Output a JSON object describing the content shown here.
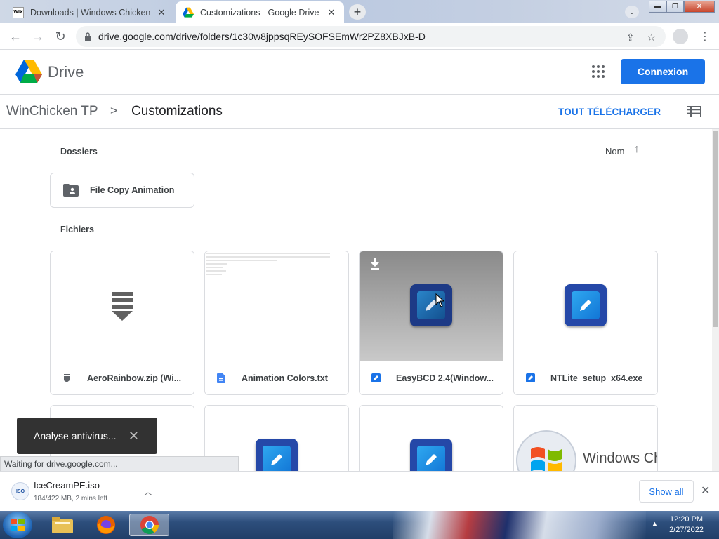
{
  "browser": {
    "tabs": [
      {
        "title": "Downloads | Windows Chicken",
        "favicon": "wix-icon",
        "active": false
      },
      {
        "title": "Customizations - Google Drive",
        "favicon": "drive-icon",
        "active": true
      }
    ],
    "url": "drive.google.com/drive/folders/1c30w8jppsqREySOFSEmWr2PZ8XBJxB-D",
    "status_text": "Waiting for drive.google.com..."
  },
  "drive": {
    "app_name": "Drive",
    "signin_label": "Connexion",
    "breadcrumb": [
      "WinChicken TP",
      "Customizations"
    ],
    "download_all_label": "TOUT TÉLÉCHARGER",
    "sections": {
      "folders_label": "Dossiers",
      "files_label": "Fichiers"
    },
    "sort_label": "Nom",
    "folders": [
      {
        "name": "File Copy Animation"
      }
    ],
    "files": [
      {
        "name": "AeroRainbow.zip (Wi...",
        "type_icon": "zip-icon",
        "thumb": "zip-icon"
      },
      {
        "name": "Animation Colors.txt",
        "type_icon": "doc-icon",
        "thumb": "text-preview"
      },
      {
        "name": "EasyBCD 2.4(Window...",
        "type_icon": "exe-icon",
        "thumb": "app-icon",
        "hovered": true
      },
      {
        "name": "NTLite_setup_x64.exe",
        "type_icon": "exe-icon",
        "thumb": "app-icon"
      }
    ],
    "partial_row": [
      {
        "thumb": "blank"
      },
      {
        "thumb": "app-icon"
      },
      {
        "thumb": "app-icon"
      },
      {
        "thumb": "windows-logo",
        "text": "Windows Ch"
      }
    ]
  },
  "toast": {
    "text": "Analyse antivirus..."
  },
  "downloads": {
    "file": "IceCreamPE.iso",
    "progress": "184/422 MB, 2 mins left",
    "show_all_label": "Show all"
  },
  "taskbar": {
    "time": "12:20 PM",
    "date": "2/27/2022"
  },
  "colors": {
    "accent": "#1a73e8",
    "toast_bg": "#323232"
  }
}
